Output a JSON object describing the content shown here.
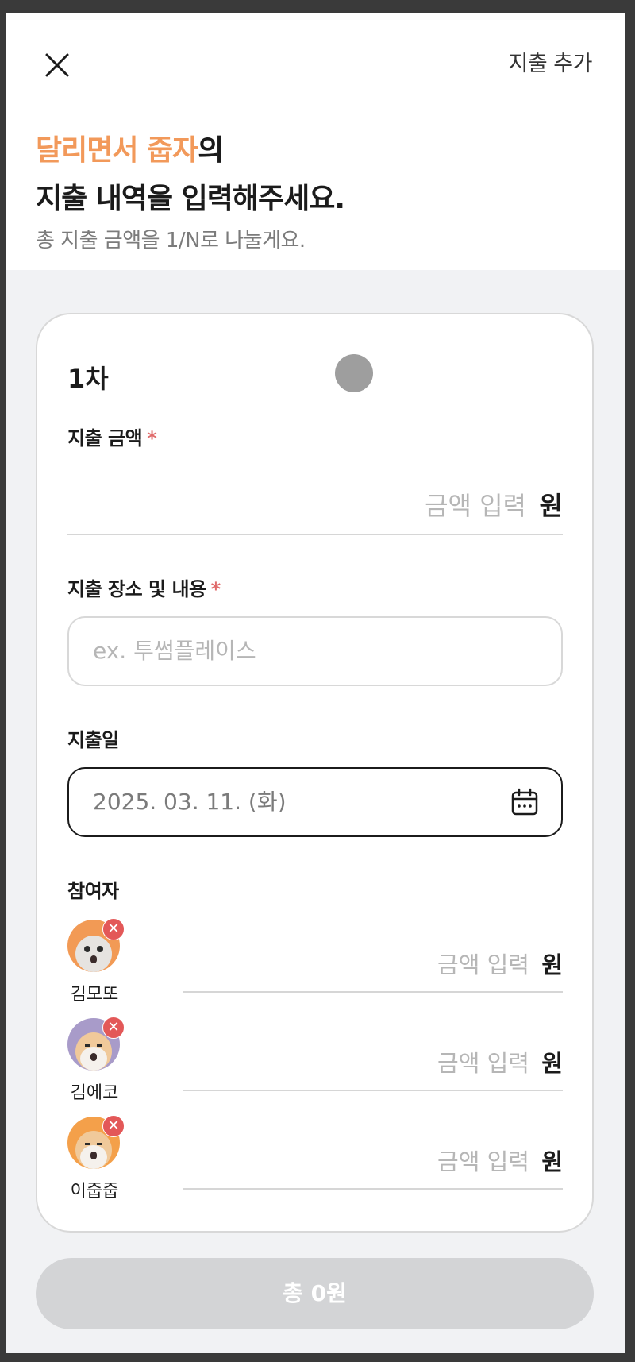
{
  "header": {
    "add_expense_label": "지출 추가",
    "title_highlight": "달리면서 줍자",
    "title_suffix": "의",
    "title_line2": "지출 내역을 입력해주세요.",
    "subtitle": "총 지출 금액을 1/N로 나눌게요."
  },
  "card": {
    "round_title": "1차",
    "amount_label": "지출 금액",
    "required_mark": "*",
    "amount_placeholder": "금액 입력",
    "currency_unit": "원",
    "place_label": "지출 장소 및 내용",
    "place_placeholder": "ex. 투썸플레이스",
    "date_label": "지출일",
    "date_value": "2025. 03. 11. (화)",
    "participants_label": "참여자",
    "participants": [
      {
        "name": "김모또",
        "avatar_color": "#f29a55",
        "amount_placeholder": "금액 입력",
        "unit": "원"
      },
      {
        "name": "김에코",
        "avatar_color": "#a89bc9",
        "amount_placeholder": "금액 입력",
        "unit": "원"
      },
      {
        "name": "이줍줍",
        "avatar_color": "#f4a04a",
        "amount_placeholder": "금액 입력",
        "unit": "원"
      }
    ]
  },
  "footer": {
    "total_label": "총 0원"
  },
  "colors": {
    "accent": "#f2995a",
    "required": "#e06b6b",
    "remove_badge": "#e35858",
    "disabled_button": "#d3d4d6"
  },
  "icons": [
    "close-icon",
    "calendar-icon",
    "remove-icon",
    "avatar-hamster-icon"
  ]
}
